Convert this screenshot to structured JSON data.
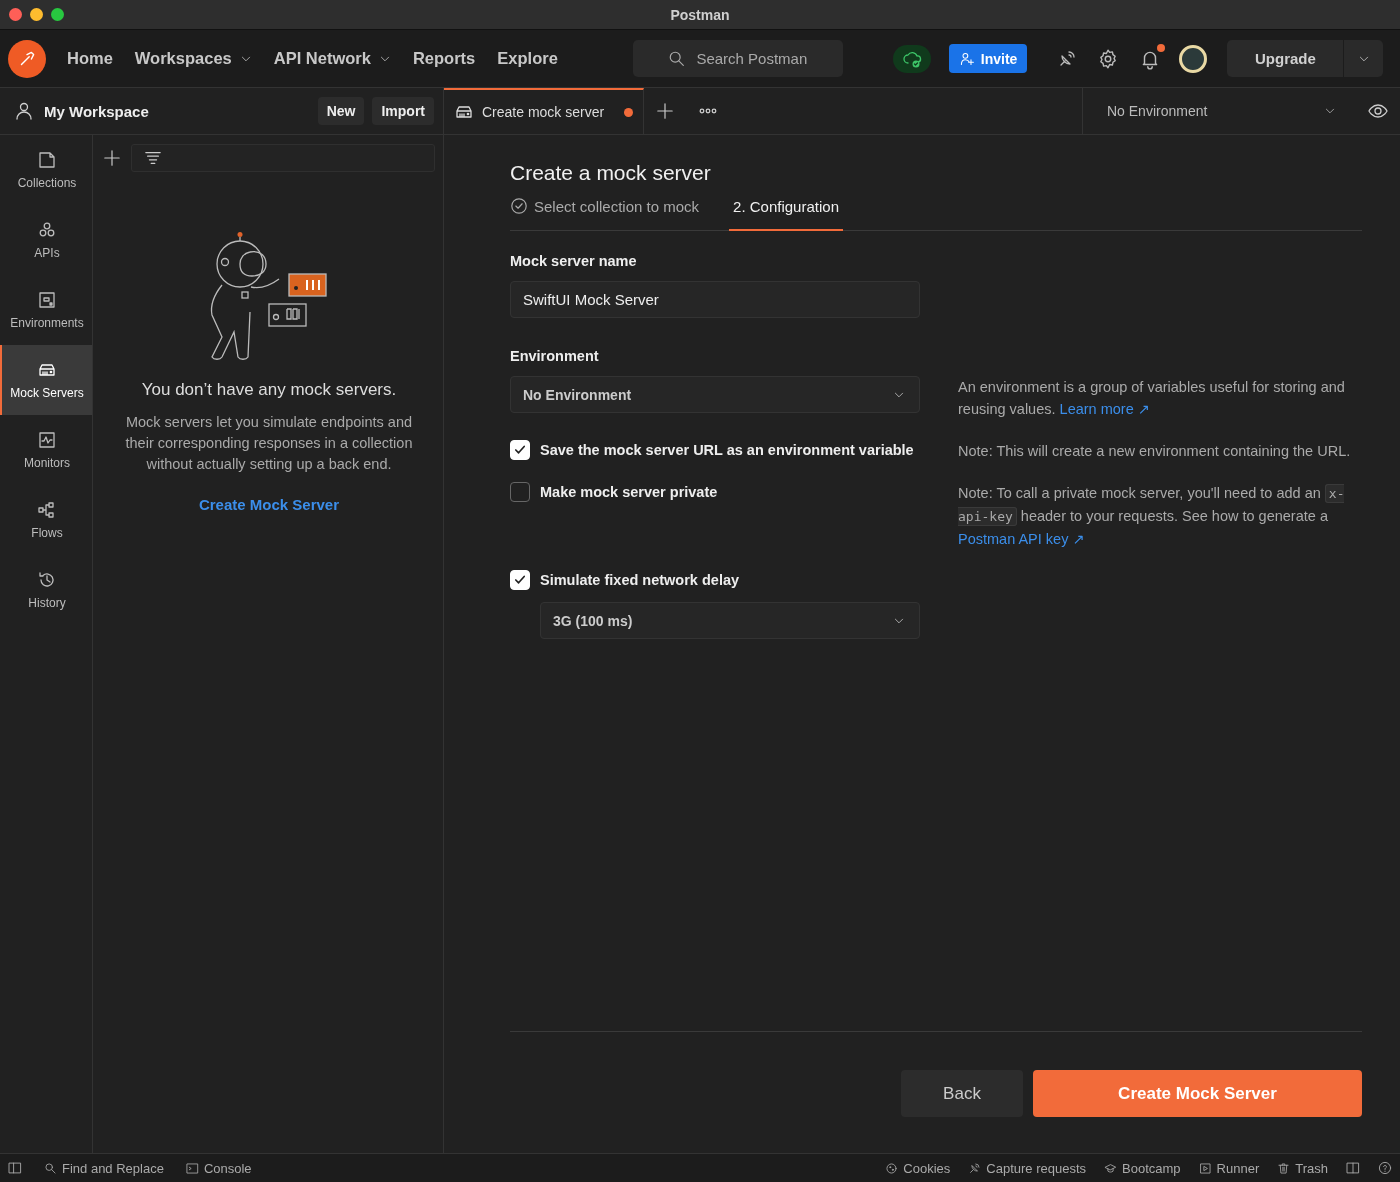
{
  "window": {
    "title": "Postman"
  },
  "nav": {
    "items": [
      {
        "label": "Home",
        "dropdown": false
      },
      {
        "label": "Workspaces",
        "dropdown": true
      },
      {
        "label": "API Network",
        "dropdown": true
      },
      {
        "label": "Reports",
        "dropdown": false
      },
      {
        "label": "Explore",
        "dropdown": false
      }
    ],
    "search": {
      "placeholder": "Search Postman"
    },
    "invite": "Invite",
    "upgrade": "Upgrade"
  },
  "workspace": {
    "title": "My Workspace",
    "buttons": [
      "New",
      "Import"
    ]
  },
  "sidebar": {
    "items": [
      {
        "label": "Collections",
        "kind": "collections",
        "selected": false
      },
      {
        "label": "APIs",
        "kind": "apis",
        "selected": false
      },
      {
        "label": "Environments",
        "kind": "environments",
        "selected": false
      },
      {
        "label": "Mock Servers",
        "kind": "mocks",
        "selected": true
      },
      {
        "label": "Monitors",
        "kind": "monitors",
        "selected": false
      },
      {
        "label": "Flows",
        "kind": "flows",
        "selected": false
      },
      {
        "label": "History",
        "kind": "history",
        "selected": false
      }
    ]
  },
  "panel": {
    "empty_title": "You don’t have any mock servers.",
    "empty_text": "Mock servers let you simulate endpoints and their corresponding responses in a collection without actually setting up a back end.",
    "action": "Create Mock Server"
  },
  "tabs": [
    {
      "label": "Create mock server",
      "selected": true,
      "unsaved": true
    }
  ],
  "environment_selector": {
    "value": "No Environment"
  },
  "form": {
    "title": "Create a mock server",
    "steps": [
      {
        "label": "Select collection to mock",
        "done": true,
        "selected": false
      },
      {
        "label": "2. Configuration",
        "done": false,
        "selected": true
      }
    ],
    "fields": [
      {
        "kind": "text",
        "label": "Mock server name",
        "value": "SwiftUI Mock Server"
      },
      {
        "kind": "select",
        "label": "Environment",
        "value": "No Environment",
        "note": {
          "text": "An environment is a group of variables useful for storing and reusing values.",
          "link": "Learn more ↗"
        }
      },
      {
        "kind": "checkbox",
        "label": "Save the mock server URL as an environment variable",
        "checked": true,
        "note": {
          "text": "Note: This will create a new environment containing the URL."
        }
      },
      {
        "kind": "checkbox",
        "label": "Make mock server private",
        "checked": false,
        "note": {
          "text": "Note: To call a private mock server, you'll need to add an",
          "code": "x-api-key",
          "text_after": "header to your requests. See how to generate a",
          "link": "Postman API key ↗"
        }
      },
      {
        "kind": "checkbox",
        "label": "Simulate fixed network delay",
        "checked": true,
        "select": "3G (100 ms)"
      }
    ],
    "buttons": {
      "back": "Back",
      "submit": "Create Mock Server"
    }
  },
  "status_bar": {
    "left": [
      {
        "label": "Find and Replace",
        "kind": "search"
      },
      {
        "label": "Console",
        "kind": "console"
      }
    ],
    "right": [
      {
        "label": "Cookies",
        "kind": "cookies"
      },
      {
        "label": "Capture requests",
        "kind": "capture"
      },
      {
        "label": "Bootcamp",
        "kind": "bootcamp"
      },
      {
        "label": "Runner",
        "kind": "runner"
      },
      {
        "label": "Trash",
        "kind": "trash"
      }
    ]
  }
}
